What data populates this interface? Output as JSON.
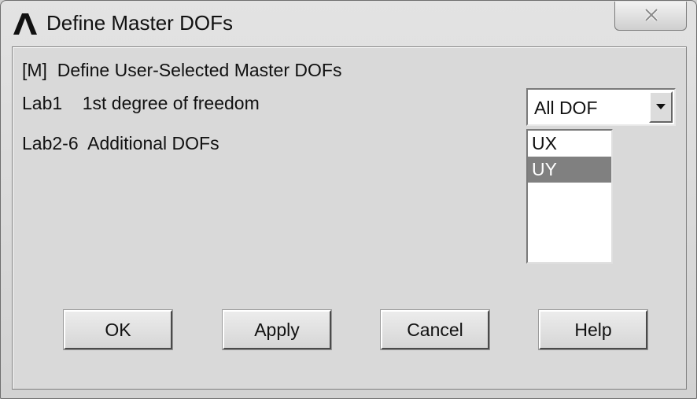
{
  "window": {
    "title": "Define Master DOFs",
    "app_icon": "ansys-logo-icon",
    "close_label": "close-icon"
  },
  "form": {
    "header": "[M]  Define User-Selected Master DOFs",
    "lab1_label": "Lab1    1st degree of freedom",
    "lab2_label": "Lab2-6  Additional DOFs",
    "lab1_select": {
      "value": "All DOF"
    },
    "lab2_list": {
      "items": [
        "UX",
        "UY"
      ],
      "selected": "UY"
    }
  },
  "buttons": {
    "ok": "OK",
    "apply": "Apply",
    "cancel": "Cancel",
    "help": "Help"
  },
  "colors": {
    "selection": "#808080",
    "dialog_bg": "#d9d9d9"
  }
}
